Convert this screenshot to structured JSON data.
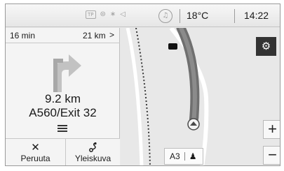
{
  "status_bar": {
    "traffic_program": "TP",
    "icons": [
      "tp-icon",
      "phone-ring-icon",
      "bluetooth-icon",
      "volume-icon",
      "music-icon"
    ],
    "temperature": "18°C",
    "time": "14:22"
  },
  "guidance": {
    "remaining_time": "16 min",
    "remaining_distance": "21 km",
    "more_chevron": ">",
    "maneuver_icon": "turn-right-arrow-icon",
    "maneuver_distance": "9.2 km",
    "maneuver_road": "A560/Exit 32"
  },
  "buttons": {
    "cancel_glyph": "✕",
    "cancel_label": "Peruuta",
    "overview_glyph": "route-overview-icon",
    "overview_label": "Yleiskuva"
  },
  "map": {
    "settings_icon": "gear-icon",
    "zoom_in_label": "+",
    "zoom_out_label": "−",
    "road_label": "A3",
    "poi_icon": "pedestrian-icon"
  },
  "colors": {
    "route": "#6f6f6f",
    "panel_bg": "#f4f4f4",
    "map_bg": "#e8e8e8",
    "settings_bg": "#333333"
  }
}
